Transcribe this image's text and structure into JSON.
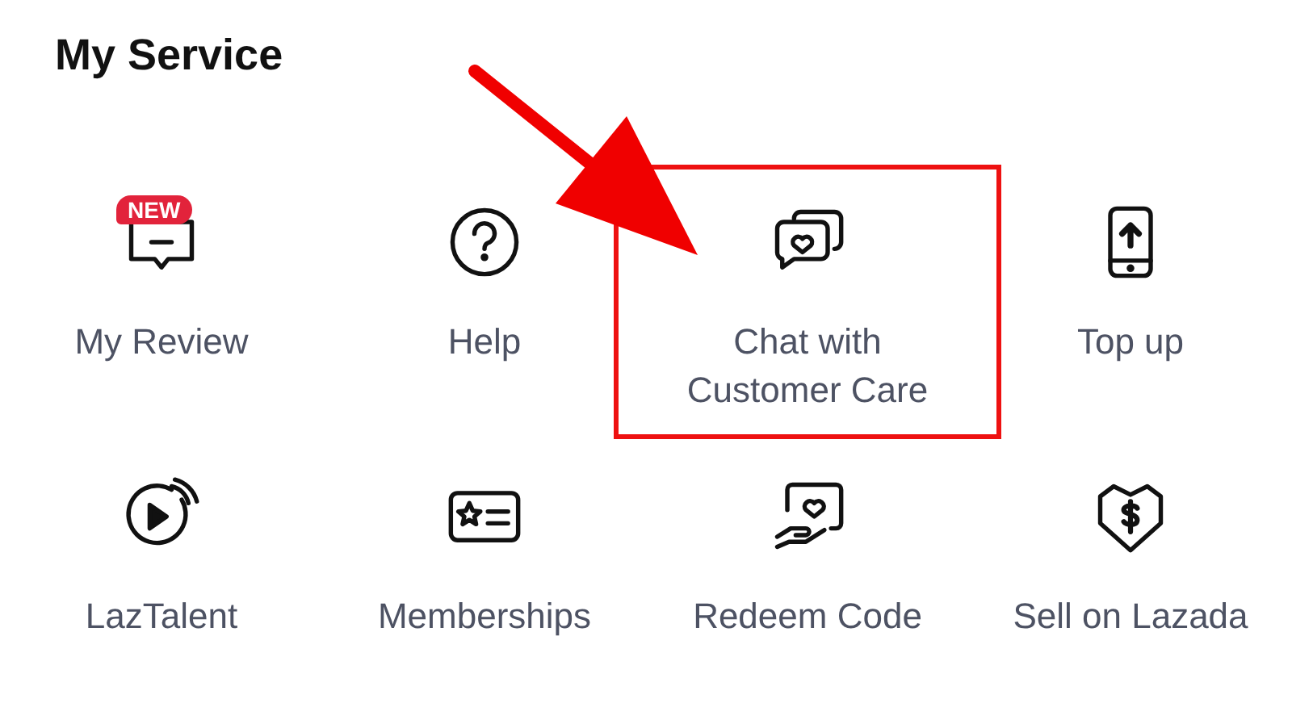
{
  "title": "My Service",
  "items": [
    {
      "label": "My Review",
      "badge": "NEW",
      "highlighted": false
    },
    {
      "label": "Help",
      "highlighted": false
    },
    {
      "label": "Chat with Customer Care",
      "highlighted": true
    },
    {
      "label": "Top up",
      "highlighted": false
    },
    {
      "label": "LazTalent",
      "highlighted": false
    },
    {
      "label": "Memberships",
      "highlighted": false
    },
    {
      "label": "Redeem Code",
      "highlighted": false
    },
    {
      "label": "Sell on Lazada",
      "highlighted": false
    }
  ]
}
